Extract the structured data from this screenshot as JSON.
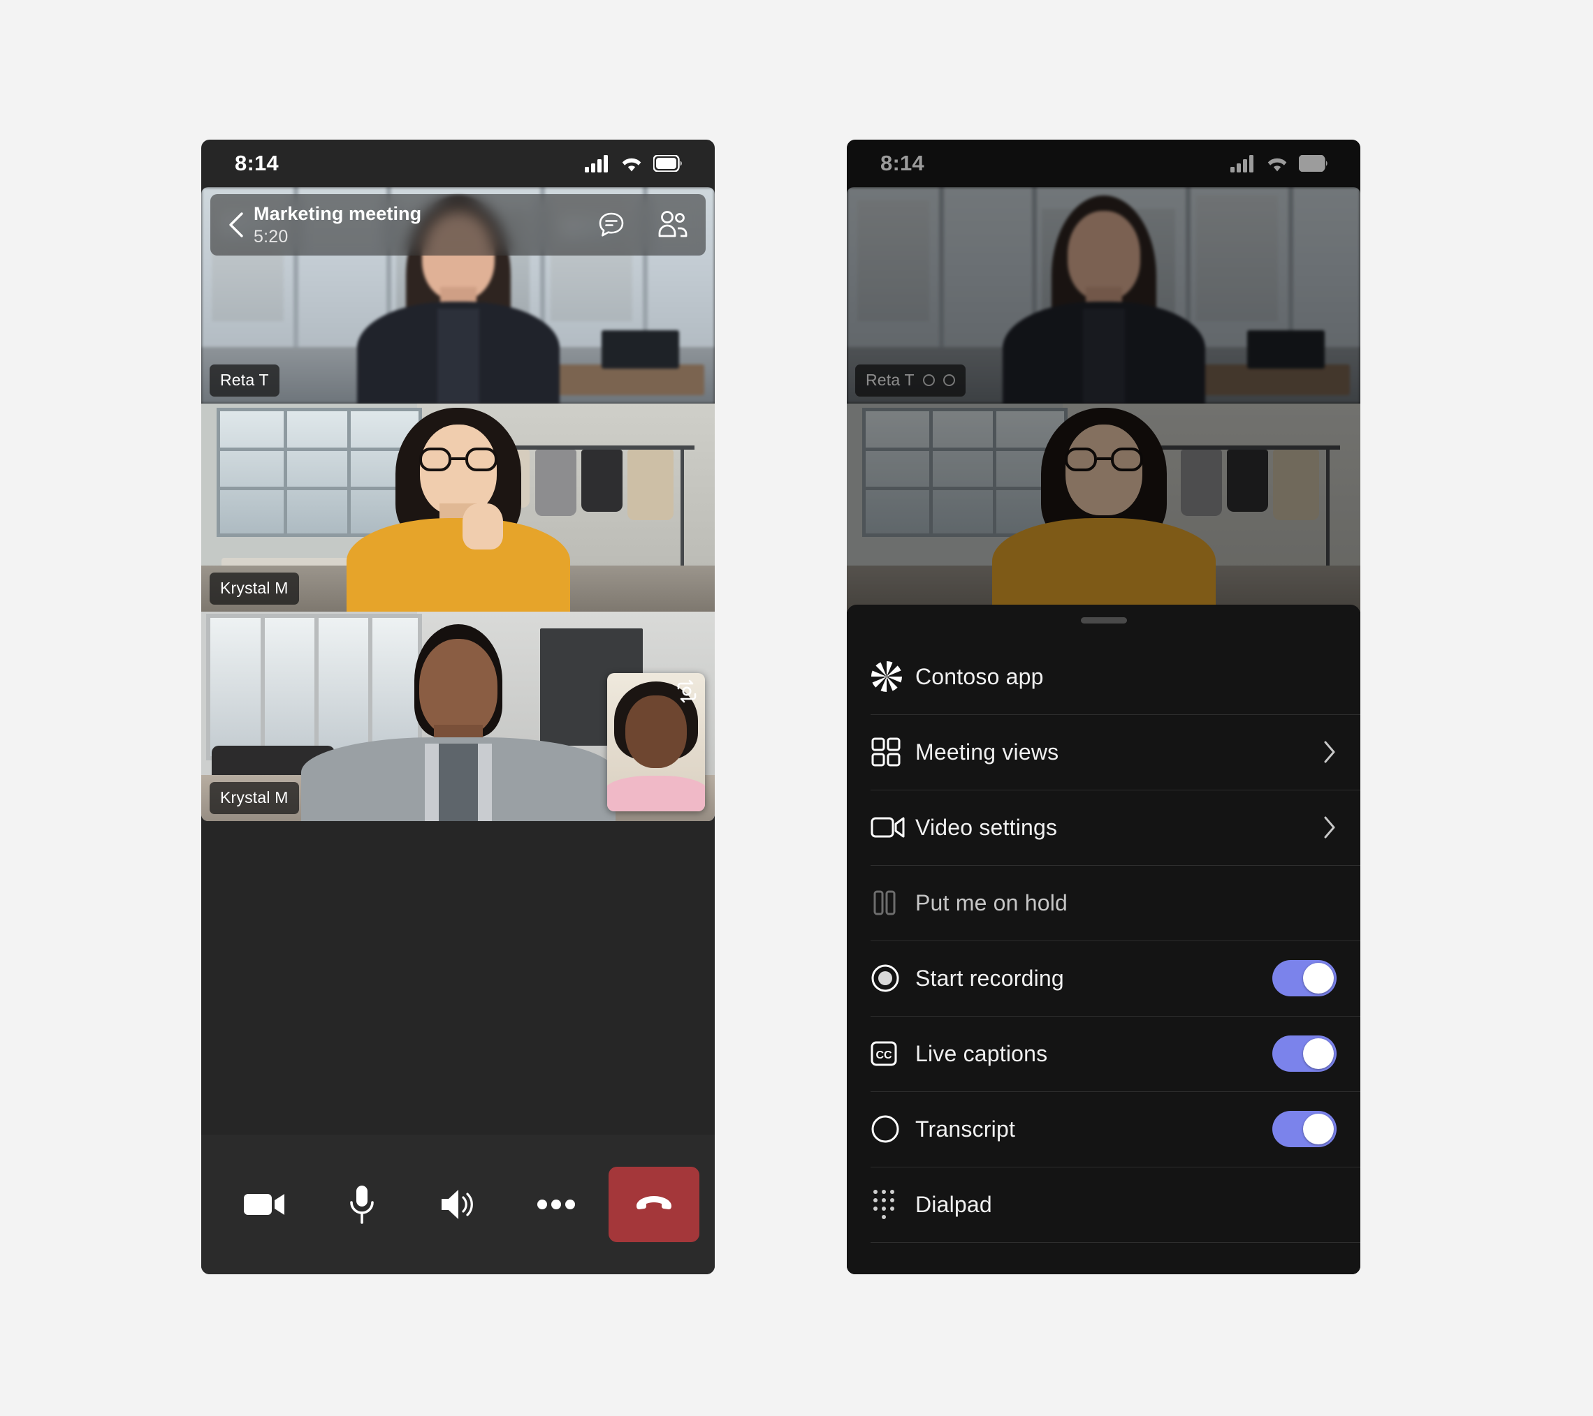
{
  "canvas": {
    "background": "#f3f3f3"
  },
  "colors": {
    "phone_chrome": "#262626",
    "sheet_bg": "#141414",
    "toggle_on": "#7b83eb",
    "hangup_red": "#a4373a",
    "divider": "#2e2e2e"
  },
  "left_phone": {
    "status_bar": {
      "time": "8:14",
      "icons": [
        "cellular-signal-icon",
        "wifi-icon",
        "battery-icon"
      ]
    },
    "meeting_header": {
      "back_icon": "back-chevron-icon",
      "title": "Marketing meeting",
      "timer": "5:20",
      "actions": [
        {
          "name": "chat-icon",
          "label": "Chat"
        },
        {
          "name": "participants-icon",
          "label": "Participants"
        }
      ]
    },
    "tiles": [
      {
        "name": "Reta T",
        "badges": []
      },
      {
        "name": "Krystal M",
        "badges": []
      },
      {
        "name": "Krystal M",
        "badges": []
      }
    ],
    "pip": {
      "flip_icon": "camera-flip-icon",
      "label": "Self view"
    },
    "controls": [
      {
        "name": "camera-button",
        "icon": "video-camera-icon",
        "label": "Camera"
      },
      {
        "name": "microphone-button",
        "icon": "microphone-icon",
        "label": "Mic"
      },
      {
        "name": "speaker-button",
        "icon": "speaker-icon",
        "label": "Speaker"
      },
      {
        "name": "more-button",
        "icon": "ellipsis-icon",
        "label": "More"
      },
      {
        "name": "hangup-button",
        "icon": "hangup-phone-icon",
        "label": "Leave"
      }
    ]
  },
  "right_phone": {
    "status_bar": {
      "time": "8:14",
      "icons": [
        "cellular-signal-icon",
        "wifi-icon",
        "battery-icon"
      ]
    },
    "tiles": [
      {
        "name": "Reta T",
        "badges": [
          "mute-circle-indicator",
          "pin-circle-indicator"
        ]
      }
    ],
    "sheet": {
      "grabber": "drag-handle",
      "items": [
        {
          "label": "Contoso app",
          "icon": "contoso-pinwheel-icon",
          "trailing": "none",
          "toggle": null,
          "dimmed": false
        },
        {
          "label": "Meeting views",
          "icon": "grid-2x2-icon",
          "trailing": "chevron",
          "toggle": null,
          "dimmed": false
        },
        {
          "label": "Video settings",
          "icon": "video-camera-icon",
          "trailing": "chevron",
          "toggle": null,
          "dimmed": false
        },
        {
          "label": "Put me on hold",
          "icon": "pause-icon",
          "trailing": "none",
          "toggle": null,
          "dimmed": true
        },
        {
          "label": "Start recording",
          "icon": "record-circle-icon",
          "trailing": "toggle",
          "toggle": "on",
          "dimmed": false
        },
        {
          "label": "Live captions",
          "icon": "closed-caption-icon",
          "trailing": "toggle",
          "toggle": "on",
          "dimmed": false
        },
        {
          "label": "Transcript",
          "icon": "circle-outline-icon",
          "trailing": "toggle",
          "toggle": "on",
          "dimmed": false
        },
        {
          "label": "Dialpad",
          "icon": "dialpad-dots-icon",
          "trailing": "none",
          "toggle": null,
          "dimmed": false
        }
      ]
    }
  }
}
